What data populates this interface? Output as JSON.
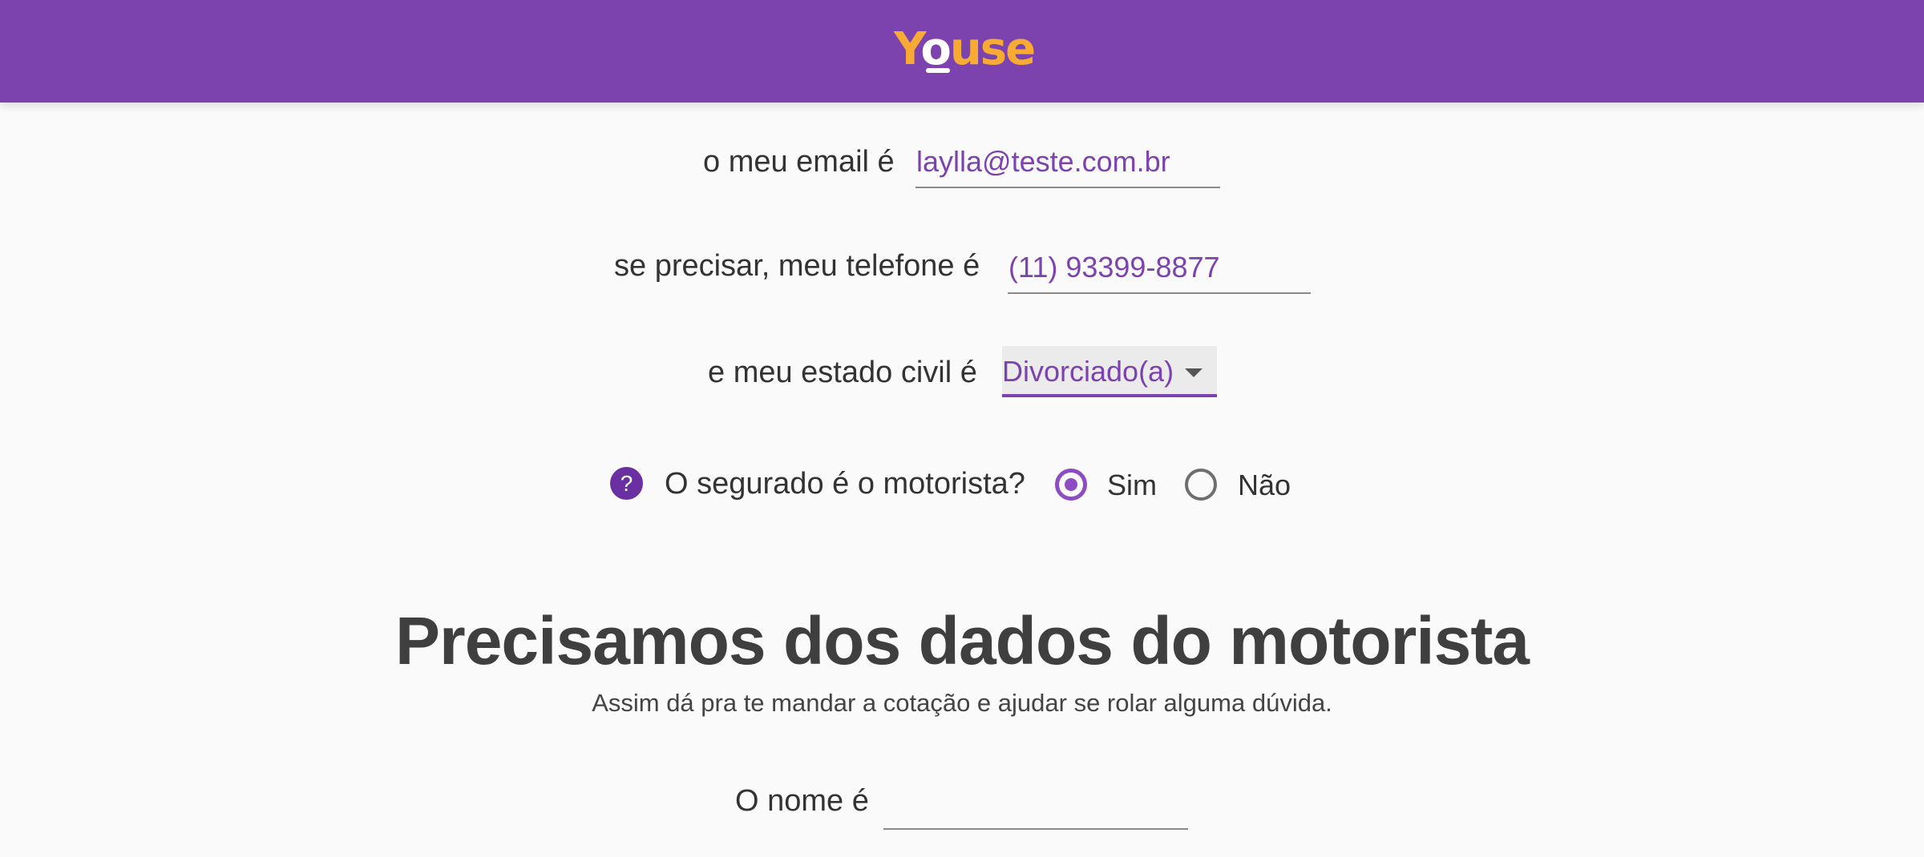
{
  "header": {
    "logo_text_y": "Y",
    "logo_text_o": "o",
    "logo_text_use": "use",
    "background_color": "#7c42ae",
    "logo_color": "#f7ab34"
  },
  "form": {
    "email": {
      "label": "o meu email é",
      "value": "laylla@teste.com.br"
    },
    "phone": {
      "label": "se precisar, meu telefone é",
      "value": "(11) 93399-8877"
    },
    "marital_status": {
      "label": "e meu estado civil é",
      "value": "Divorciado(a)",
      "icon": "chevron-down-icon"
    },
    "driver_question": {
      "help_icon": "question-circle-icon",
      "help_glyph": "?",
      "label": "O segurado é o motorista?",
      "options": [
        {
          "label": "Sim",
          "checked": true
        },
        {
          "label": "Não",
          "checked": false
        }
      ]
    }
  },
  "driver_section": {
    "title": "Precisamos dos dados do motorista",
    "subtitle": "Assim dá pra te mandar a cotação e ajudar se rolar alguma dúvida.",
    "name_label": "O nome é",
    "name_value": ""
  },
  "colors": {
    "accent": "#7c42ae",
    "radio_accent": "#8e4cc2",
    "text": "#333333",
    "title": "#3f3f3f"
  }
}
